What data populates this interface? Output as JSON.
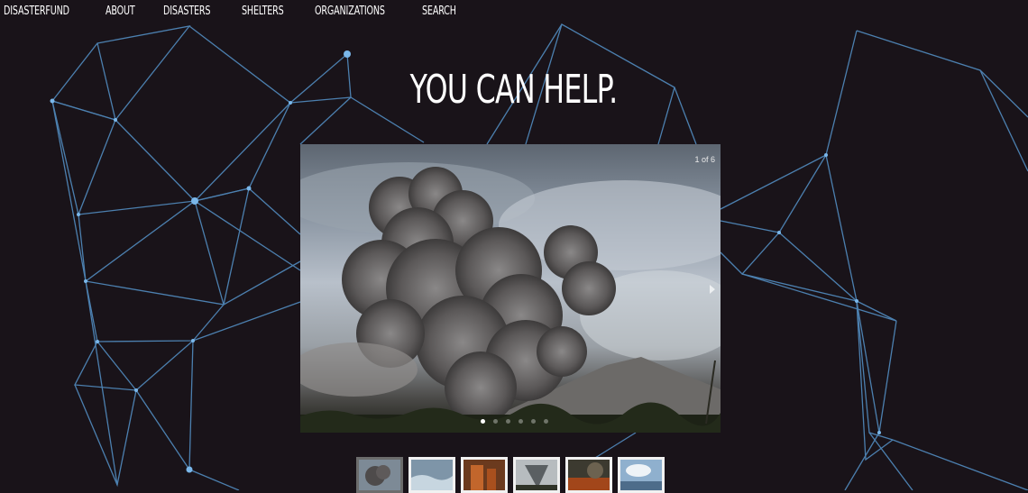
{
  "nav": {
    "items": [
      "DISASTERFUND",
      "ABOUT",
      "DISASTERS",
      "SHELTERS",
      "ORGANIZATIONS",
      "SEARCH"
    ]
  },
  "hero": {
    "title": "YOU CAN HELP."
  },
  "slider": {
    "counter": "1 of 6",
    "current_slide": 1,
    "total_slides": 6
  },
  "colors": {
    "background": "#191319",
    "network_line": "#5b8fbf",
    "network_node": "#7ab7ea"
  }
}
